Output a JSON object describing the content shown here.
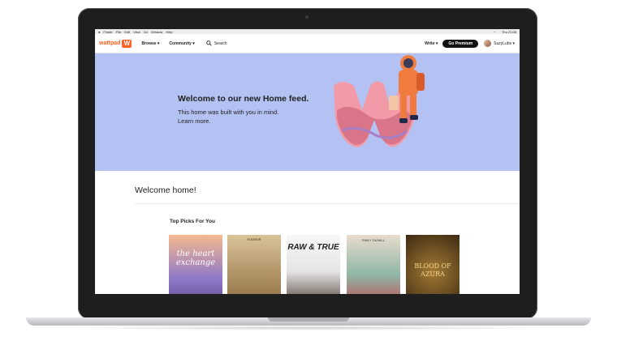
{
  "menubar": {
    "items": [
      "Finder",
      "File",
      "Edit",
      "View",
      "Go",
      "Window",
      "Help"
    ],
    "clock": "Thu 21:08"
  },
  "nav": {
    "logo_text": "wattpad",
    "logo_mark": "W",
    "browse_label": "Browse ▾",
    "community_label": "Community ▾",
    "search_label": "Search",
    "write_label": "Write ▾",
    "premium_label": "Go Premium",
    "username": "SuzyLubs ▾"
  },
  "hero": {
    "title": "Welcome to our new Home feed.",
    "subtitle": "This home was built with you in mind.",
    "link": "Learn more."
  },
  "feed": {
    "welcome": "Welcome home!",
    "section_title": "Top Picks For You"
  },
  "books": [
    {
      "title": "the heart exchange",
      "cover_color": "#8f78c9"
    },
    {
      "author": "ELEANOR",
      "cover_color": "#b79763"
    },
    {
      "title": "RAW & TRUE",
      "cover_color": "#eeeeee"
    },
    {
      "author": "EMILY DUVALL",
      "cover_color": "#d6c7b6"
    },
    {
      "title": "BLOOD OF AZURA",
      "cover_color": "#6b4b22"
    }
  ],
  "colors": {
    "brand": "#ff6122",
    "hero_bg": "#b4c1f3",
    "premium_bg": "#121212"
  }
}
